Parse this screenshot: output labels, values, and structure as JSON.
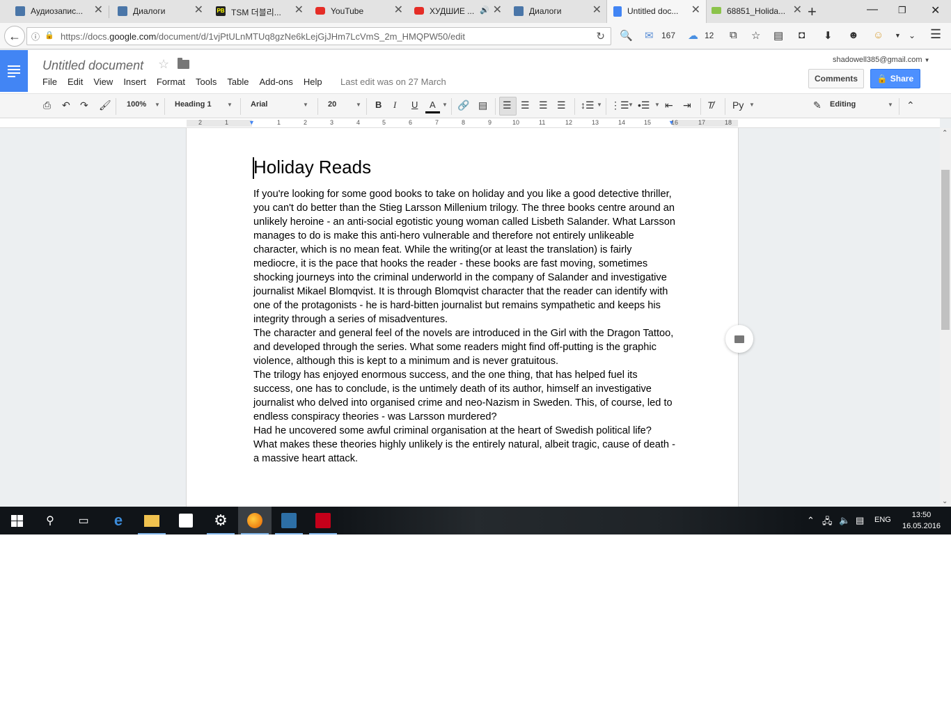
{
  "tabs": [
    {
      "label": "Аудиозапис...",
      "icon": "vk-audio-icon",
      "color": "#4a76a8"
    },
    {
      "label": "Диалоги",
      "icon": "vk-chat-icon",
      "color": "#4a76a8"
    },
    {
      "label": "TSM 더블리...",
      "icon": "pb-icon",
      "color": "#222222"
    },
    {
      "label": "YouTube",
      "icon": "youtube-icon",
      "color": "#e52d27"
    },
    {
      "label": "ХУДШИЕ ...",
      "icon": "youtube-icon",
      "color": "#e52d27"
    },
    {
      "label": "Диалоги",
      "icon": "vk-chat-icon",
      "color": "#4a76a8"
    },
    {
      "label": "Untitled doc...",
      "icon": "docs-icon",
      "color": "#4285f4"
    },
    {
      "label": "68851_Holida...",
      "icon": "image-icon",
      "color": "#8bc34a"
    }
  ],
  "address": {
    "prefix": "https://docs.",
    "domain": "google.com",
    "path": "/document/d/1vjPtULnMTUq8gzNe6kLejGjJHm7LcVmS_2m_HMQPW50/edit"
  },
  "nav": {
    "mail_count": "167",
    "cloud_count": "12"
  },
  "doc": {
    "title": "Untitled document",
    "menu": [
      "File",
      "Edit",
      "View",
      "Insert",
      "Format",
      "Tools",
      "Table",
      "Add-ons",
      "Help"
    ],
    "last_edit": "Last edit was on 27 March",
    "account": "shadowell385@gmail.com",
    "comments_label": "Comments",
    "share_label": "Share"
  },
  "toolbar": {
    "zoom": "100%",
    "style": "Heading 1",
    "font": "Arial",
    "size": "20",
    "bold": "B",
    "italic": "I",
    "underline": "U",
    "text_color": "A",
    "input_tools": "Ру",
    "mode": "Editing"
  },
  "ruler": [
    "2",
    "1",
    "1",
    "2",
    "3",
    "4",
    "5",
    "6",
    "7",
    "8",
    "9",
    "10",
    "11",
    "12",
    "13",
    "14",
    "15",
    "16",
    "17",
    "18"
  ],
  "content": {
    "heading": "Holiday Reads",
    "paragraphs": [
      "If you're looking for some good books to take on holiday and you like a good detective thriller, you can't do better than the Stieg Larsson Millenium trilogy. The three books centre around an unlikely heroine - an anti-social egotistic young woman called Lisbeth Salander. What Larsson manages to do is make this anti-hero vulnerable and therefore not entirely unlikeable character, which is no mean feat. While the writing(or at least the translation) is fairly mediocre, it is the pace that hooks the reader - these books are fast moving, sometimes shocking journeys into the criminal underworld in the company of Salander and investigative journalist Mikael Blomqvist. It is through Blomqvist character that the reader can identify with one of the protagonists - he is hard-bitten journalist but remains sympathetic and keeps his integrity through a series of misadventures.",
      "The character and general feel of the novels are introduced in the Girl with the Dragon Tattoo, and developed through the series. What some readers might find off-putting is the graphic violence, although this is kept to a minimum and is never gratuitous.",
      "The trilogy has enjoyed enormous success, and the one thing, that has helped fuel its success, one has to conclude, is the untimely death of its author, himself an investigative journalist  who delved into organised crime and neo-Nazism in Sweden. This, of course, led to endless conspiracy theories  - was Larsson murdered?",
      "Had he uncovered some awful criminal organisation at the heart of Swedish political life? What makes these theories highly unlikely is the entirely natural, albeit tragic, cause of death - a massive heart attack."
    ]
  },
  "taskbar": {
    "lang": "ENG",
    "time": "13:50",
    "date": "16.05.2016"
  }
}
